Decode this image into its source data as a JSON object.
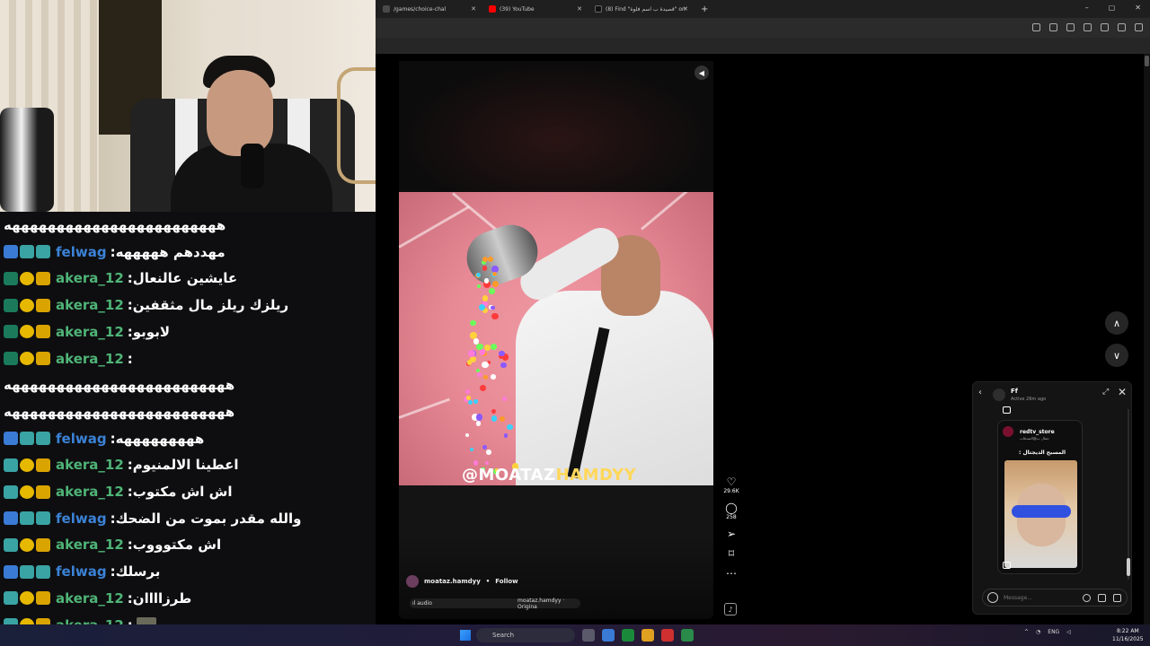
{
  "browser": {
    "tabs": [
      {
        "title": "/games/choice-chal",
        "icon_color": "#4a4a4a"
      },
      {
        "title": "(39) YouTube",
        "icon_color": "#ff0000"
      },
      {
        "title": "(8) Find \"قصيدة ب اسم فلوة\" on",
        "icon_color": "#111111"
      }
    ],
    "new_tab": "+",
    "window_controls": [
      "–",
      "▢",
      "✕"
    ]
  },
  "chat": {
    "messages": [
      {
        "user": "",
        "text": "ههههههههههههههههههههههههه",
        "color": "plain",
        "badges": []
      },
      {
        "user": "felwag",
        "text": "مهددهم هههههه",
        "color": "blue",
        "badges": [
          "b-blue",
          "b-teal",
          "b-teal"
        ]
      },
      {
        "user": "akera_12",
        "text": "عايشين عالنعال",
        "color": "green",
        "badges": [
          "b-green",
          "b-yellow",
          "b-gold"
        ]
      },
      {
        "user": "akera_12",
        "text": "ريلزك ريلز مال مثقفين",
        "color": "green",
        "badges": [
          "b-green",
          "b-yellow",
          "b-gold"
        ]
      },
      {
        "user": "akera_12",
        "text": "لابوبو",
        "color": "green",
        "badges": [
          "b-green",
          "b-yellow",
          "b-gold"
        ]
      },
      {
        "user": "akera_12",
        "text": "",
        "color": "green",
        "badges": [
          "b-green",
          "b-yellow",
          "b-gold"
        ]
      },
      {
        "user": "",
        "text": "هههههههههههههههههههههههههه",
        "color": "plain",
        "badges": []
      },
      {
        "user": "",
        "text": "هههههههههههههههههههههههههه",
        "color": "plain",
        "badges": []
      },
      {
        "user": "felwag",
        "text": "هههههههههه",
        "color": "blue",
        "badges": [
          "b-blue",
          "b-teal",
          "b-teal"
        ]
      },
      {
        "user": "akera_12",
        "text": "اعطينا الالمنيوم",
        "color": "green",
        "badges": [
          "b-teal",
          "b-yellow",
          "b-gold"
        ]
      },
      {
        "user": "akera_12",
        "text": "اش اش مكتوب",
        "color": "green",
        "badges": [
          "b-teal",
          "b-yellow",
          "b-gold"
        ]
      },
      {
        "user": "felwag",
        "text": "والله مقدر بموت من الضحك",
        "color": "blue",
        "badges": [
          "b-blue",
          "b-teal",
          "b-teal"
        ]
      },
      {
        "user": "akera_12",
        "text": "اش مكتوووب",
        "color": "green",
        "badges": [
          "b-teal",
          "b-yellow",
          "b-gold"
        ]
      },
      {
        "user": "felwag",
        "text": "برسلك",
        "color": "blue",
        "badges": [
          "b-blue",
          "b-teal",
          "b-teal"
        ]
      },
      {
        "user": "akera_12",
        "text": "طرزاااان",
        "color": "green",
        "badges": [
          "b-teal",
          "b-yellow",
          "b-gold"
        ]
      },
      {
        "user": "akera_12",
        "text": "",
        "color": "green",
        "badges": [
          "b-teal",
          "b-yellow",
          "b-gold"
        ],
        "emote": true
      }
    ]
  },
  "reel": {
    "watermark_a": "@MOATAZ",
    "watermark_b": "HAMDYY",
    "author": "moataz.hamdyy",
    "separator": "•",
    "follow_label": "Follow",
    "audio": "ıl audio",
    "audio_original": "moataz.hamdyy · Origina",
    "likes": "29.6K",
    "comments": "258",
    "mute_icon": "speaker-icon"
  },
  "dm": {
    "name": "Ff",
    "status": "Active 26m ago",
    "post_user": "redtv_store",
    "post_sub": "جمال ب@الصدقات",
    "post_caption": "المسبح الديجتال :",
    "input_placeholder": "Message..."
  },
  "taskbar": {
    "search_label": "Search",
    "lang": "ENG",
    "time": "8:22 AM",
    "date": "11/16/2025",
    "apps": [
      "#5a5a6a",
      "#3a7bd5",
      "#1a8a3a",
      "#e0a020",
      "#d03030",
      "#2a8a4a"
    ]
  }
}
